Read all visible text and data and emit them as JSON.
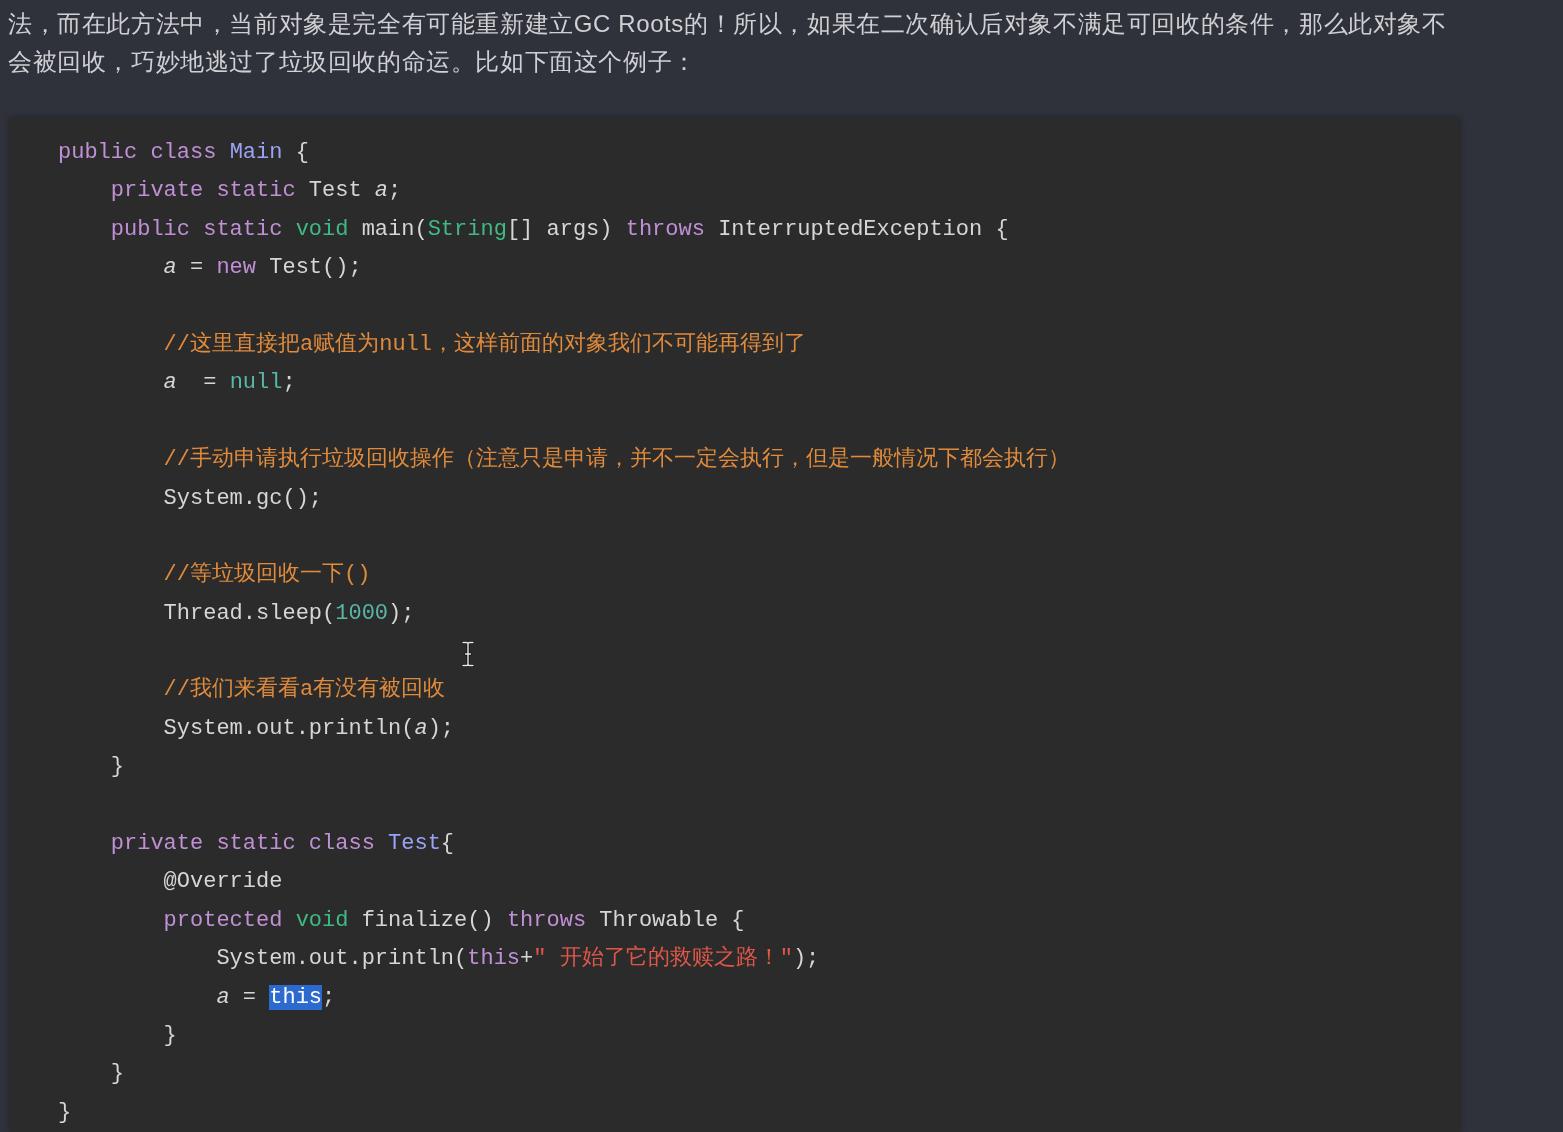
{
  "intro": {
    "lines": [
      "法，而在此方法中，当前对象是完全有可能重新建立GC Roots的！所以，如果在二次确认后对象不满足可回收的条件，那么此对象不",
      "会被回收，巧妙地逃过了垃圾回收的命运。比如下面这个例子："
    ]
  },
  "code_block": {
    "lines": [
      {
        "kind": "code",
        "tokens": [
          {
            "kind": "keyword",
            "text": "public class "
          },
          {
            "kind": "class",
            "text": "Main"
          },
          {
            "kind": "plain",
            "text": " {"
          }
        ],
        "children": [
          {
            "kind": "code",
            "tokens": [
              {
                "kind": "keyword",
                "text": "private static "
              },
              {
                "kind": "plain",
                "text": "Test "
              },
              {
                "kind": "field",
                "text": "a"
              },
              {
                "kind": "plain",
                "text": ";"
              }
            ]
          },
          {
            "kind": "code",
            "tokens": [
              {
                "kind": "keyword",
                "text": "public static "
              },
              {
                "kind": "type",
                "text": "void "
              },
              {
                "kind": "plain",
                "text": "main("
              },
              {
                "kind": "type",
                "text": "String"
              },
              {
                "kind": "plain",
                "text": "[] args) "
              },
              {
                "kind": "keyword",
                "text": "throws "
              },
              {
                "kind": "plain",
                "text": "InterruptedException {"
              }
            ],
            "children": [
              {
                "kind": "code",
                "tokens": [
                  {
                    "kind": "field",
                    "text": "a"
                  },
                  {
                    "kind": "plain",
                    "text": " = "
                  },
                  {
                    "kind": "keyword",
                    "text": "new "
                  },
                  {
                    "kind": "plain",
                    "text": "Test();"
                  }
                ]
              },
              {
                "kind": "blank"
              },
              {
                "kind": "code",
                "tokens": [
                  {
                    "kind": "comment",
                    "text": "//这里直接把a赋值为null，这样前面的对象我们不可能再得到了"
                  }
                ]
              },
              {
                "kind": "code",
                "tokens": [
                  {
                    "kind": "field",
                    "text": "a"
                  },
                  {
                    "kind": "plain",
                    "text": "  = "
                  },
                  {
                    "kind": "literal",
                    "text": "null"
                  },
                  {
                    "kind": "plain",
                    "text": ";"
                  }
                ]
              },
              {
                "kind": "blank"
              },
              {
                "kind": "code",
                "tokens": [
                  {
                    "kind": "comment",
                    "text": "//手动申请执行垃圾回收操作（注意只是申请，并不一定会执行，但是一般情况下都会执行）"
                  }
                ]
              },
              {
                "kind": "code",
                "tokens": [
                  {
                    "kind": "plain",
                    "text": "System.gc();"
                  }
                ]
              },
              {
                "kind": "blank"
              },
              {
                "kind": "code",
                "tokens": [
                  {
                    "kind": "comment",
                    "text": "//等垃圾回收一下()"
                  }
                ]
              },
              {
                "kind": "code",
                "tokens": [
                  {
                    "kind": "plain",
                    "text": "Thread.sleep("
                  },
                  {
                    "kind": "literal",
                    "text": "1000"
                  },
                  {
                    "kind": "plain",
                    "text": ");"
                  }
                ]
              },
              {
                "kind": "blank"
              },
              {
                "kind": "code",
                "tokens": [
                  {
                    "kind": "comment",
                    "text": "//我们来看看a有没有被回收"
                  }
                ]
              },
              {
                "kind": "code",
                "tokens": [
                  {
                    "kind": "plain",
                    "text": "System.out.println("
                  },
                  {
                    "kind": "field",
                    "text": "a"
                  },
                  {
                    "kind": "plain",
                    "text": ");"
                  }
                ]
              }
            ]
          },
          {
            "kind": "code",
            "tokens": [
              {
                "kind": "plain",
                "text": "}"
              }
            ]
          },
          {
            "kind": "blank"
          },
          {
            "kind": "code",
            "tokens": [
              {
                "kind": "keyword",
                "text": "private static class "
              },
              {
                "kind": "class",
                "text": "Test"
              },
              {
                "kind": "plain",
                "text": "{"
              }
            ],
            "children": [
              {
                "kind": "code",
                "tokens": [
                  {
                    "kind": "plain",
                    "text": "@Override"
                  }
                ]
              },
              {
                "kind": "code",
                "tokens": [
                  {
                    "kind": "keyword",
                    "text": "protected "
                  },
                  {
                    "kind": "type",
                    "text": "void "
                  },
                  {
                    "kind": "plain",
                    "text": "finalize() "
                  },
                  {
                    "kind": "keyword",
                    "text": "throws "
                  },
                  {
                    "kind": "plain",
                    "text": "Throwable {"
                  }
                ],
                "children": [
                  {
                    "kind": "code",
                    "tokens": [
                      {
                        "kind": "plain",
                        "text": "System.out.println("
                      },
                      {
                        "kind": "keyword",
                        "text": "this"
                      },
                      {
                        "kind": "plain",
                        "text": "+"
                      },
                      {
                        "kind": "string",
                        "text": "\" 开始了它的救赎之路！\""
                      },
                      {
                        "kind": "plain",
                        "text": ");"
                      }
                    ]
                  },
                  {
                    "kind": "code",
                    "tokens": [
                      {
                        "kind": "field",
                        "text": "a"
                      },
                      {
                        "kind": "plain",
                        "text": " = "
                      },
                      {
                        "kind": "selection",
                        "text": "this"
                      },
                      {
                        "kind": "plain",
                        "text": ";"
                      }
                    ]
                  }
                ]
              },
              {
                "kind": "code",
                "tokens": [
                  {
                    "kind": "plain",
                    "text": "}"
                  }
                ]
              }
            ]
          },
          {
            "kind": "code",
            "tokens": [
              {
                "kind": "plain",
                "text": "}"
              }
            ]
          }
        ]
      },
      {
        "kind": "code",
        "tokens": [
          {
            "kind": "plain",
            "text": "}"
          }
        ]
      }
    ]
  }
}
